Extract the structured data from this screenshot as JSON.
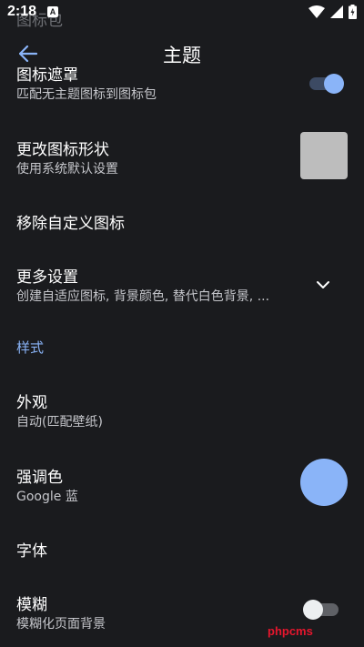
{
  "status_bar": {
    "time": "2:18",
    "notification_badge": "A",
    "icons": [
      "wifi-icon",
      "signal-icon",
      "battery-charging-icon"
    ]
  },
  "header": {
    "title": "主题",
    "scrolled_behind": "图标包"
  },
  "settings": {
    "icon_mask": {
      "title": "图标遮罩",
      "subtitle": "匹配无主题图标到图标包",
      "enabled": true
    },
    "icon_shape": {
      "title": "更改图标形状",
      "subtitle": "使用系统默认设置"
    },
    "remove_custom_icons": {
      "title": "移除自定义图标"
    },
    "more_settings": {
      "title": "更多设置",
      "subtitle": "创建自适应图标, 背景颜色, 替代白色背景, ..."
    },
    "style_section": {
      "header": "样式"
    },
    "appearance": {
      "title": "外观",
      "subtitle": "自动(匹配壁纸)"
    },
    "accent_color": {
      "title": "强调色",
      "subtitle": "Google 蓝",
      "color": "#8ab4f8"
    },
    "font": {
      "title": "字体"
    },
    "blur": {
      "title": "模糊",
      "subtitle": "模糊化页面背景",
      "enabled": false
    }
  },
  "colors": {
    "background": "#1a1b1e",
    "accent": "#8ab4f8",
    "toggle_on_track": "#3c4a63",
    "toggle_off_track": "#5f6166",
    "toggle_off_thumb": "#eceff1"
  },
  "watermark": "phpcms"
}
